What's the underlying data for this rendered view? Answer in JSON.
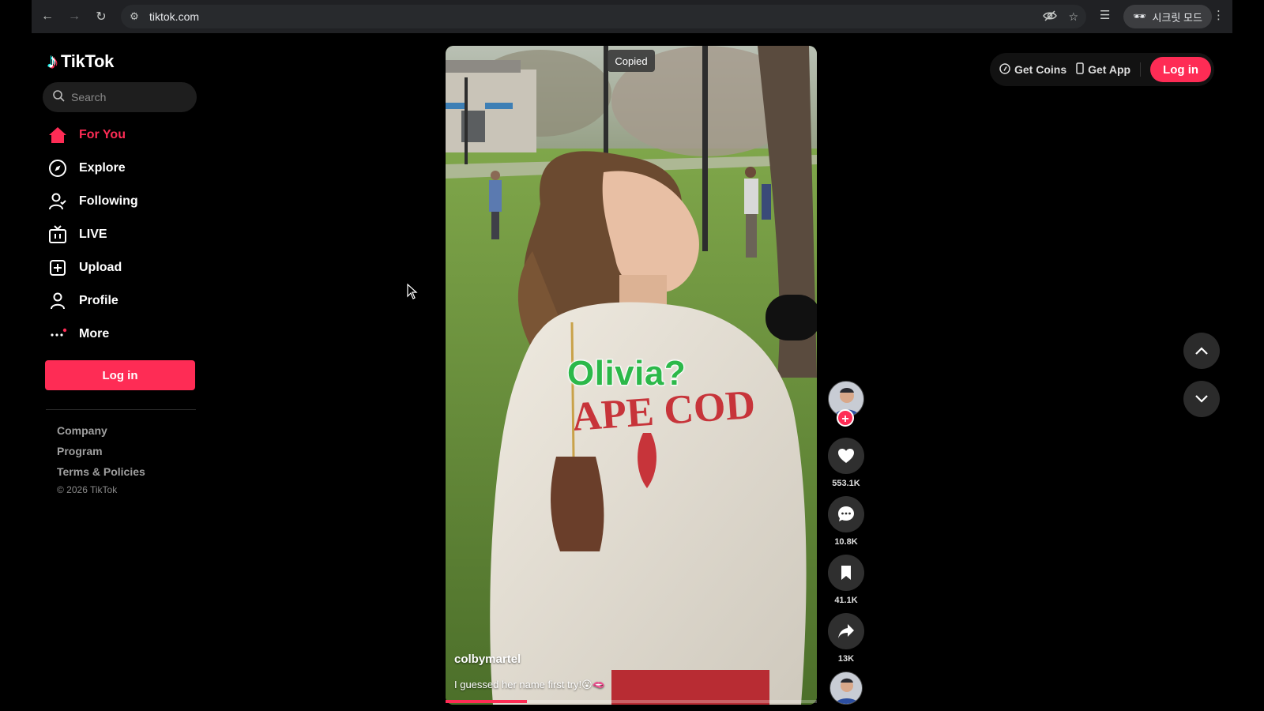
{
  "browser": {
    "url": "tiktok.com",
    "incognito_label": "시크릿 모드"
  },
  "sidebar": {
    "logo_text": "TikTok",
    "search_placeholder": "Search",
    "menu": [
      {
        "label": "For You",
        "icon": "home-icon",
        "active": true
      },
      {
        "label": "Explore",
        "icon": "compass-icon",
        "active": false
      },
      {
        "label": "Following",
        "icon": "following-icon",
        "active": false
      },
      {
        "label": "LIVE",
        "icon": "live-tv-icon",
        "active": false
      },
      {
        "label": "Upload",
        "icon": "upload-plus-icon",
        "active": false
      },
      {
        "label": "Profile",
        "icon": "profile-icon",
        "active": false
      },
      {
        "label": "More",
        "icon": "more-dots-icon",
        "active": false
      }
    ],
    "login_label": "Log in",
    "footer": {
      "company": "Company",
      "program": "Program",
      "terms": "Terms & Policies",
      "copyright": "© 2026 TikTok"
    }
  },
  "video": {
    "toast": "Copied",
    "overlay_text": "Olivia?",
    "username": "colbymartel",
    "description": "I guessed her name first try!😮🫦",
    "progress": 0.22
  },
  "actions": {
    "likes": "553.1K",
    "comments": "10.8K",
    "saves": "41.1K",
    "shares": "13K"
  },
  "topbar": {
    "get_coins": "Get Coins",
    "get_app": "Get App",
    "login": "Log in"
  },
  "colors": {
    "brand": "#fe2c55",
    "overlay_text": "#2cb84a"
  }
}
